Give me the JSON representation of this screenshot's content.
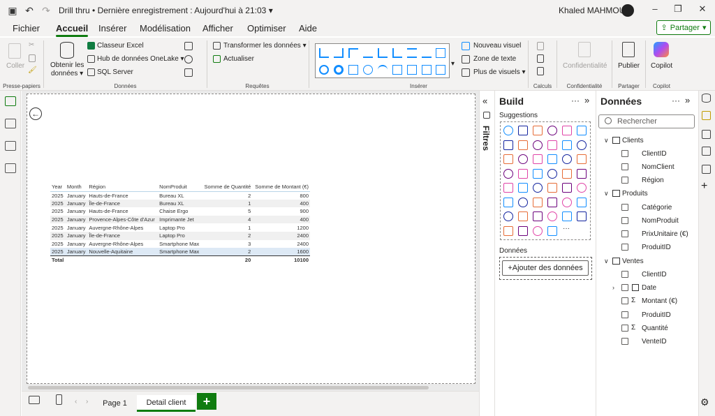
{
  "titlebar": {
    "title": "Drill thru",
    "separator": "•",
    "last_saved": "Dernière enregistrement : Aujourd'hui à 21:03",
    "account": "Khaled MAHMOUD"
  },
  "menu": {
    "tabs": [
      "Fichier",
      "Accueil",
      "Insérer",
      "Modélisation",
      "Afficher",
      "Optimiser",
      "Aide"
    ],
    "share_label": "Partager"
  },
  "ribbon": {
    "clipboard": {
      "paste": "Coller",
      "group": "Presse-papiers"
    },
    "data": {
      "get_data": "Obtenir les",
      "get_data2": "données",
      "excel": "Classeur Excel",
      "onelake": "Hub de données OneLake",
      "sql": "SQL Server",
      "group": "Données"
    },
    "queries": {
      "transform": "Transformer les données",
      "refresh": "Actualiser",
      "group": "Requêtes"
    },
    "insert": {
      "new_visual": "Nouveau visuel",
      "textbox": "Zone de texte",
      "more_visuals": "Plus de visuels",
      "group": "Insérer"
    },
    "calc": {
      "group": "Calculs"
    },
    "sensitivity": {
      "label": "Confidentialité",
      "group": "Confidentialité"
    },
    "share": {
      "publish": "Publier",
      "group": "Partager"
    },
    "copilot": {
      "label": "Copilot",
      "group": "Copilot"
    }
  },
  "table": {
    "headers": [
      "Year",
      "Month",
      "Région",
      "NomProduit",
      "Somme de Quantité",
      "Somme de Montant (€)"
    ],
    "rows": [
      [
        "2025",
        "January",
        "Hauts-de-France",
        "Bureau XL",
        "2",
        "800"
      ],
      [
        "2025",
        "January",
        "Île-de-France",
        "Bureau XL",
        "1",
        "400"
      ],
      [
        "2025",
        "January",
        "Hauts-de-France",
        "Chaise Ergo",
        "5",
        "900"
      ],
      [
        "2025",
        "January",
        "Provence-Alpes-Côte d'Azur",
        "Imprimante Jet",
        "4",
        "400"
      ],
      [
        "2025",
        "January",
        "Auvergne-Rhône-Alpes",
        "Laptop Pro",
        "1",
        "1200"
      ],
      [
        "2025",
        "January",
        "Île-de-France",
        "Laptop Pro",
        "2",
        "2400"
      ],
      [
        "2025",
        "January",
        "Auvergne-Rhône-Alpes",
        "Smartphone Max",
        "3",
        "2400"
      ],
      [
        "2025",
        "January",
        "Nouvelle-Aquitaine",
        "Smartphone Max",
        "2",
        "1600"
      ]
    ],
    "total": {
      "label": "Total",
      "quantity": "20",
      "amount": "10100"
    }
  },
  "pages": {
    "tabs": [
      "Page 1",
      "Detail client"
    ],
    "active": "Detail client",
    "add": "+"
  },
  "filters_label": "Filtres",
  "build": {
    "title": "Build",
    "suggestions": "Suggestions",
    "data_label": "Données",
    "add_data": "+Ajouter des données"
  },
  "data_pane": {
    "title": "Données",
    "search_placeholder": "Rechercher",
    "tables": [
      {
        "name": "Clients",
        "fields": [
          {
            "name": "ClientID"
          },
          {
            "name": "NomClient"
          },
          {
            "name": "Région"
          }
        ]
      },
      {
        "name": "Produits",
        "fields": [
          {
            "name": "Catégorie"
          },
          {
            "name": "NomProduit"
          },
          {
            "name": "PrixUnitaire (€)"
          },
          {
            "name": "ProduitID"
          }
        ]
      },
      {
        "name": "Ventes",
        "fields": [
          {
            "name": "ClientID"
          },
          {
            "name": "Date"
          },
          {
            "name": "Montant (€)"
          },
          {
            "name": "ProduitID"
          },
          {
            "name": "Quantité"
          },
          {
            "name": "VenteID"
          }
        ]
      }
    ]
  }
}
